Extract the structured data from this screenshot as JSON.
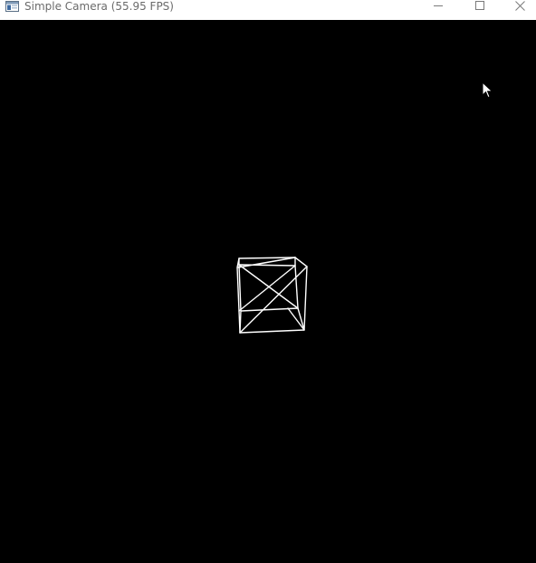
{
  "window": {
    "title": "Simple Camera (55.95 FPS)",
    "icons": {
      "app": "app-window-icon",
      "minimize": "minimize-icon",
      "maximize": "maximize-icon",
      "close": "close-icon"
    }
  },
  "viewport": {
    "background": "#000000",
    "object": "wireframe-cube",
    "line_color": "#ffffff"
  },
  "cursor": {
    "icon": "mouse-pointer-icon"
  }
}
